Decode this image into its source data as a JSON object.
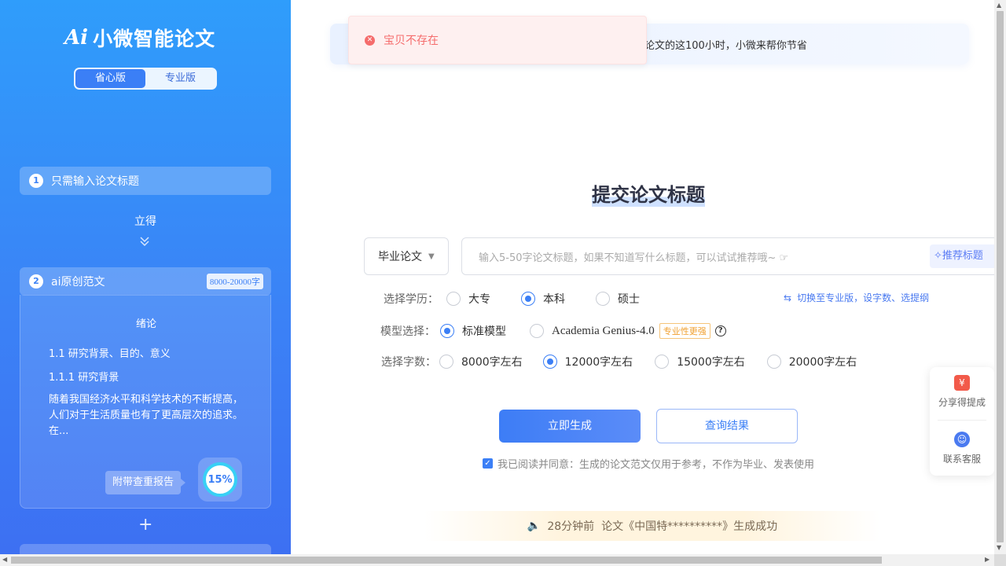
{
  "sidebar": {
    "logo_mark": "Ai",
    "logo_text": "小微智能论文",
    "versions": [
      "省心版",
      "专业版"
    ],
    "step1": {
      "num": "1",
      "label": "只需输入论文标题"
    },
    "instant": "立得",
    "step2": {
      "num": "2",
      "label": "ai原创范文",
      "badge": "8000-20000字"
    },
    "preview": {
      "heading": "绪论",
      "sec1": "1.1 研究背景、目的、意义",
      "sec2": "1.1.1 研究背景",
      "para": "随着我国经济水平和科学技术的不断提高，人们对于生活质量也有了更高层次的追求。在..."
    },
    "report_tag": "附带查重报告",
    "similarity": "15%"
  },
  "toast": {
    "message": "宝贝不存在"
  },
  "banner": {
    "text": "论文的这100小时，小微来帮你节省"
  },
  "main": {
    "title": "提交论文标题",
    "paper_type": "毕业论文",
    "input_placeholder": "输入5-50字论文标题，如果不知道写什么标题，可以试试推荐哦~",
    "recommend_label": "推荐标题",
    "education": {
      "label": "选择学历：",
      "options": [
        "大专",
        "本科",
        "硕士"
      ],
      "selected": "本科"
    },
    "switch_pro": "切换至专业版，设字数、选提纲",
    "model": {
      "label": "模型选择：",
      "options": [
        "标准模型",
        "Academia Genius-4.0"
      ],
      "selected": "标准模型",
      "pro_tag": "专业性更强"
    },
    "words": {
      "label": "选择字数：",
      "options": [
        "8000字左右",
        "12000字左右",
        "15000字左右",
        "20000字左右"
      ],
      "selected": "12000字左右"
    },
    "generate_btn": "立即生成",
    "query_btn": "查询结果",
    "agree_text": "我已阅读并同意：生成的论文范文仅用于参考，不作为毕业、发表使用",
    "notice": "28分钟前  论文《中国特**********》生成成功"
  },
  "float_panel": {
    "share": "分享得提成",
    "service": "联系客服"
  },
  "colors": {
    "accent": "#3b7ff6",
    "error": "#f56c6c",
    "tag": "#f0a030"
  }
}
